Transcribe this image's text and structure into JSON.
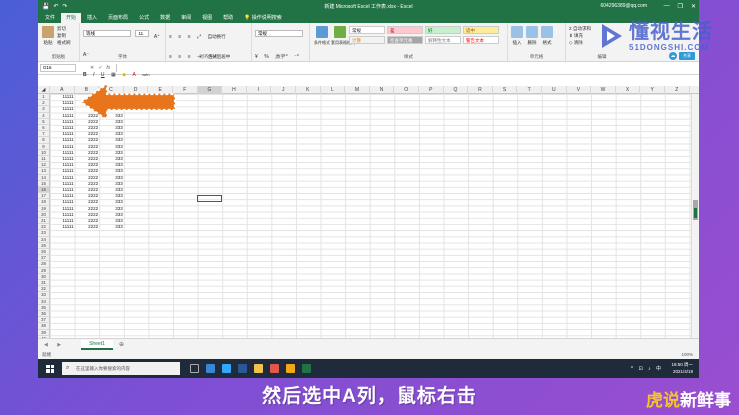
{
  "window": {
    "title": "新建 Microsoft Excel 工作表.xlsx - Excel",
    "account": "604296389@qq.com",
    "quick_access": [
      "💾",
      "↶",
      "↷"
    ],
    "win_controls": [
      "—",
      "❐",
      "✕"
    ]
  },
  "ribbon_tabs": [
    "文件",
    "开始",
    "插入",
    "页面布局",
    "公式",
    "数据",
    "审阅",
    "视图",
    "帮助"
  ],
  "tell_me": "操作说明搜索",
  "ribbon": {
    "clipboard": {
      "paste": "粘贴",
      "cut": "剪切",
      "copy": "复制",
      "format_painter": "格式刷",
      "label": "剪贴板"
    },
    "font": {
      "name": "等线",
      "size": "11",
      "label": "字体",
      "bold": "B",
      "italic": "I",
      "underline": "U",
      "grow": "A⁺",
      "shrink": "A⁻",
      "wen": "wén"
    },
    "alignment": {
      "wrap": "自动换行",
      "merge": "合并后居中",
      "label": "对齐方式"
    },
    "number": {
      "format": "常规",
      "pct": "%",
      "comma": ",",
      "label": "数字"
    },
    "styles": {
      "cond": "条件格式",
      "table": "套用表格格式",
      "cells": [
        {
          "name": "常规",
          "bg": "#ffffff",
          "fg": "#222222"
        },
        {
          "name": "差",
          "bg": "#ffc7ce",
          "fg": "#9c0006"
        },
        {
          "name": "好",
          "bg": "#c6efce",
          "fg": "#006100"
        },
        {
          "name": "适中",
          "bg": "#ffeb9c",
          "fg": "#9c5700"
        },
        {
          "name": "计算",
          "bg": "#f2f2f2",
          "fg": "#fa7d00"
        },
        {
          "name": "检查单元格",
          "bg": "#a5a5a5",
          "fg": "#ffffff"
        },
        {
          "name": "解释性文本",
          "bg": "#ffffff",
          "fg": "#7f7f7f"
        },
        {
          "name": "警告文本",
          "bg": "#ffffff",
          "fg": "#ff0000"
        }
      ],
      "label": "样式"
    },
    "cells": {
      "insert": "插入",
      "delete": "删除",
      "format": "格式",
      "label": "单元格"
    },
    "editing": {
      "autosum": "自动求和",
      "fill": "填充",
      "clear": "清除",
      "sort": "排序和筛选",
      "find": "查找和选择",
      "label": "编辑"
    }
  },
  "formula_bar": {
    "name_box": "G16",
    "cancel": "✕",
    "enter": "✓",
    "fx": "fx",
    "value": ""
  },
  "share_label": "共享",
  "columns": [
    "A",
    "B",
    "C",
    "D",
    "E",
    "F",
    "G",
    "H",
    "I",
    "J",
    "K",
    "L",
    "M",
    "N",
    "O",
    "P",
    "Q",
    "R",
    "S",
    "T",
    "U",
    "V",
    "W",
    "X",
    "Y",
    "Z"
  ],
  "row_count": 40,
  "data_rows": [
    [
      "11111",
      "",
      ""
    ],
    [
      "11111",
      "",
      ""
    ],
    [
      "11111",
      "",
      ""
    ],
    [
      "11111",
      "2222",
      "333"
    ],
    [
      "11111",
      "2222",
      "333"
    ],
    [
      "11111",
      "2222",
      "333"
    ],
    [
      "11111",
      "2222",
      "333"
    ],
    [
      "11111",
      "2222",
      "333"
    ],
    [
      "11111",
      "2222",
      "333"
    ],
    [
      "11111",
      "2222",
      "333"
    ],
    [
      "11111",
      "2222",
      "333"
    ],
    [
      "11111",
      "2222",
      "333"
    ],
    [
      "11111",
      "2222",
      "333"
    ],
    [
      "11111",
      "2222",
      "333"
    ],
    [
      "11111",
      "2222",
      "333"
    ],
    [
      "11111",
      "2222",
      "333"
    ],
    [
      "11111",
      "2222",
      "333"
    ],
    [
      "11111",
      "2222",
      "333"
    ],
    [
      "11111",
      "2222",
      "333"
    ],
    [
      "11111",
      "2222",
      "333"
    ],
    [
      "11111",
      "2222",
      "333"
    ],
    [
      "11111",
      "2222",
      "333"
    ]
  ],
  "sheet_tab": "Sheet1",
  "sheet_nav": "◀ ▶",
  "add_sheet": "⊕",
  "status_text": "就绪",
  "zoom": "100%",
  "taskbar": {
    "search_placeholder": "在这里输入你要搜索的内容",
    "time": "18:50 周一",
    "date": "2021/4/19",
    "tray": "^ ⊡ ♪ 中"
  },
  "subtitle": "然后选中A列，鼠标右击",
  "watermark": {
    "cn": "懂视生活",
    "en": "51DONGSHI.COM"
  },
  "brand": {
    "part1": "虎说",
    "part2": "新鲜事"
  },
  "colors": {
    "excel_green": "#217346",
    "arrow_orange": "#e8741c"
  }
}
